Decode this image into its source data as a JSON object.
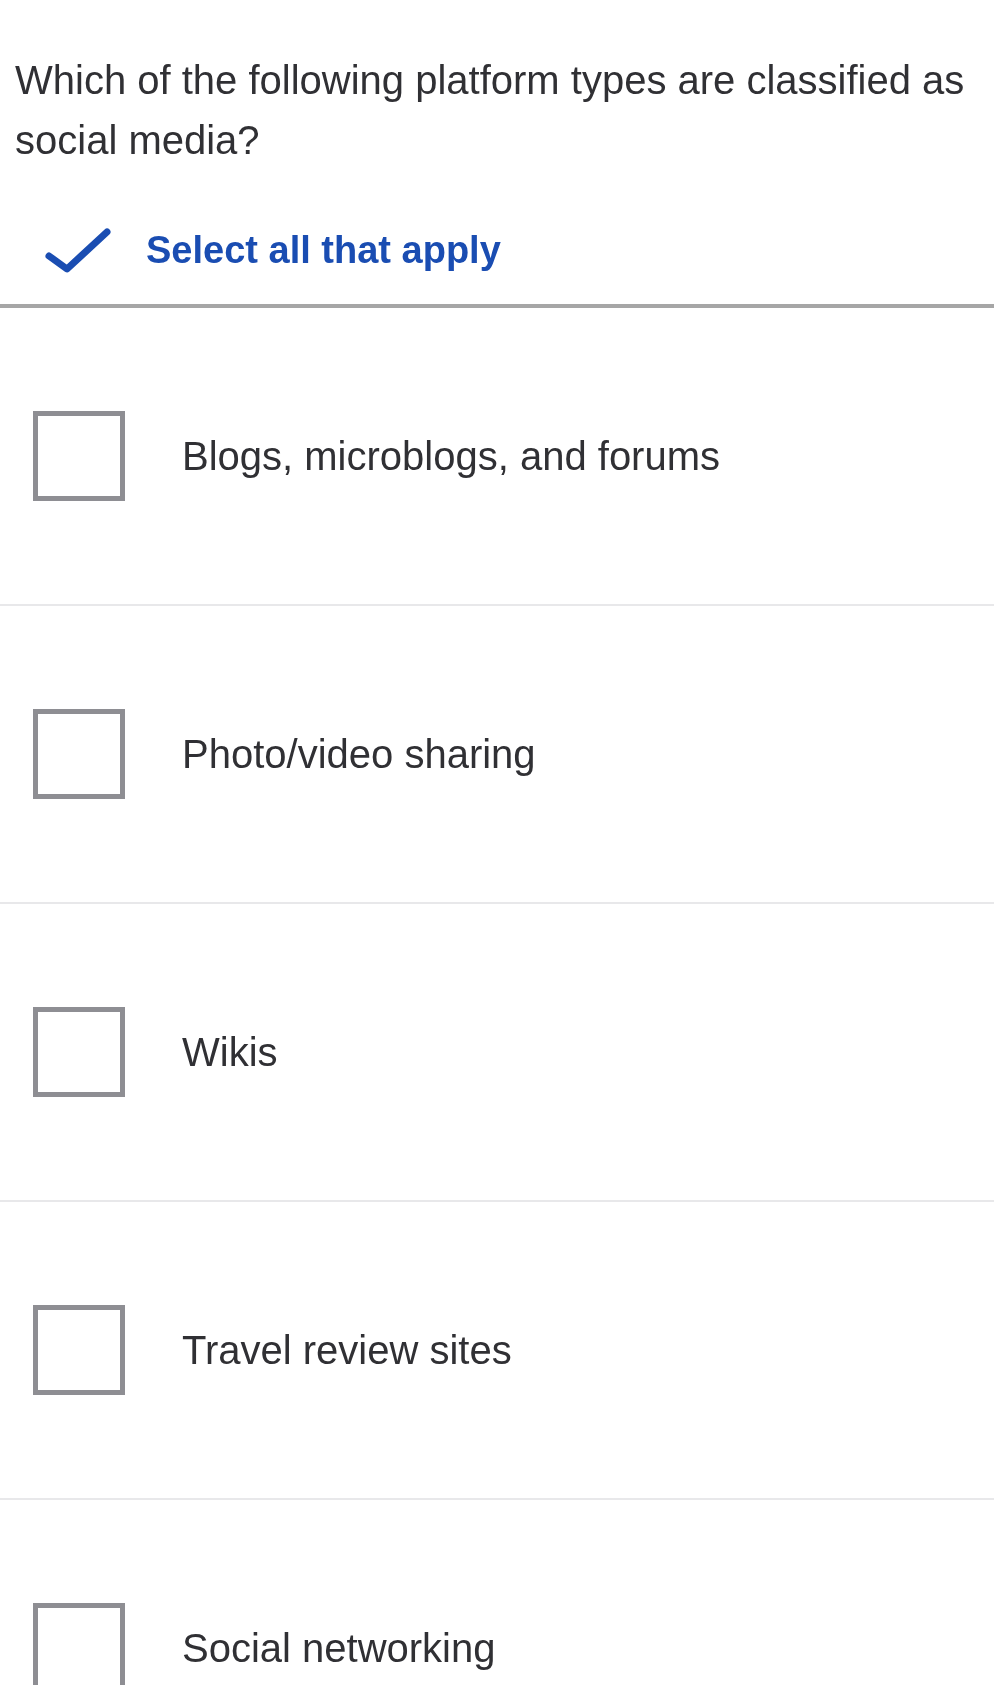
{
  "question": "Which of the following platform types are classified as social media?",
  "instruction": {
    "text": "Select all that apply"
  },
  "options": [
    {
      "label": "Blogs, microblogs, and forums",
      "checked": false
    },
    {
      "label": "Photo/video sharing",
      "checked": false
    },
    {
      "label": "Wikis",
      "checked": false
    },
    {
      "label": "Travel review sites",
      "checked": false
    },
    {
      "label": "Social networking",
      "checked": false
    }
  ]
}
